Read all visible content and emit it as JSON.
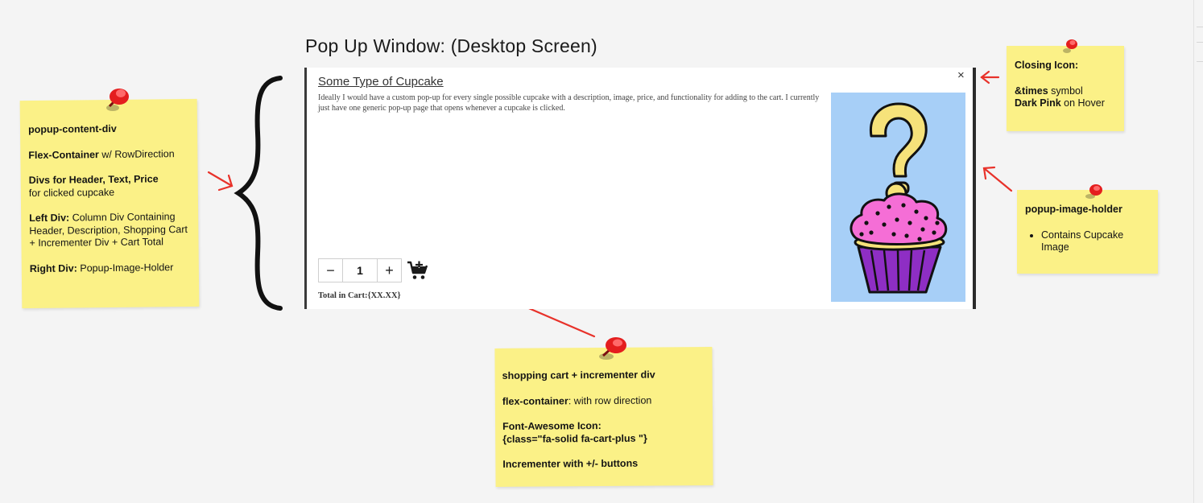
{
  "page": {
    "title": "Pop Up Window: (Desktop Screen)"
  },
  "popup": {
    "header": "Some Type of Cupcake",
    "description": "Ideally I would have a custom pop-up for every single possible cupcake with a description, image, price, and functionality for adding to the cart. I currently just have one generic pop-up page that opens whenever a cupcake is clicked.",
    "close_symbol": "×",
    "incrementer": {
      "minus": "−",
      "value": "1",
      "plus": "+"
    },
    "cart_icon": "cart-plus-icon",
    "total_label": "Total in Cart:{XX.XX}",
    "image_bg": "#a7cff7"
  },
  "notes": {
    "content_div": {
      "title": "popup-content-div",
      "flex_bold": "Flex-Container",
      "flex_rest": " w/ RowDirection",
      "divs_bold": "Divs for Header, Text, Price",
      "divs_rest": "for clicked cupcake",
      "left_bold": "Left Div:",
      "left_rest": " Column Div Containing Header, Description, Shopping Cart + Incrementer Div + Cart Total",
      "right_bold": "Right Div:",
      "right_rest": " Popup-Image-Holder"
    },
    "closing": {
      "title": "Closing Icon:",
      "times_bold": "&times",
      "times_rest": " symbol",
      "pink_bold": "Dark Pink",
      "pink_rest": " on Hover"
    },
    "image_holder": {
      "title": "popup-image-holder",
      "bullet": "Contains Cupcake Image"
    },
    "cart_div": {
      "title": "shopping cart + incrementer div",
      "flex_bold": "flex-container",
      "flex_rest": ": with row direction",
      "fa_title": "Font-Awesome Icon:",
      "fa_class": "{class=\"fa-solid fa-cart-plus \"}",
      "incrementer": "Incrementer with +/- buttons"
    }
  },
  "colors": {
    "note_yellow": "#fbf187",
    "arrow_red": "#e8322a",
    "pin_red": "#e41e1e",
    "frosting_pink": "#f56ed6",
    "wrapper_purple": "#8e2ec4",
    "question_yellow": "#f6e27a"
  }
}
